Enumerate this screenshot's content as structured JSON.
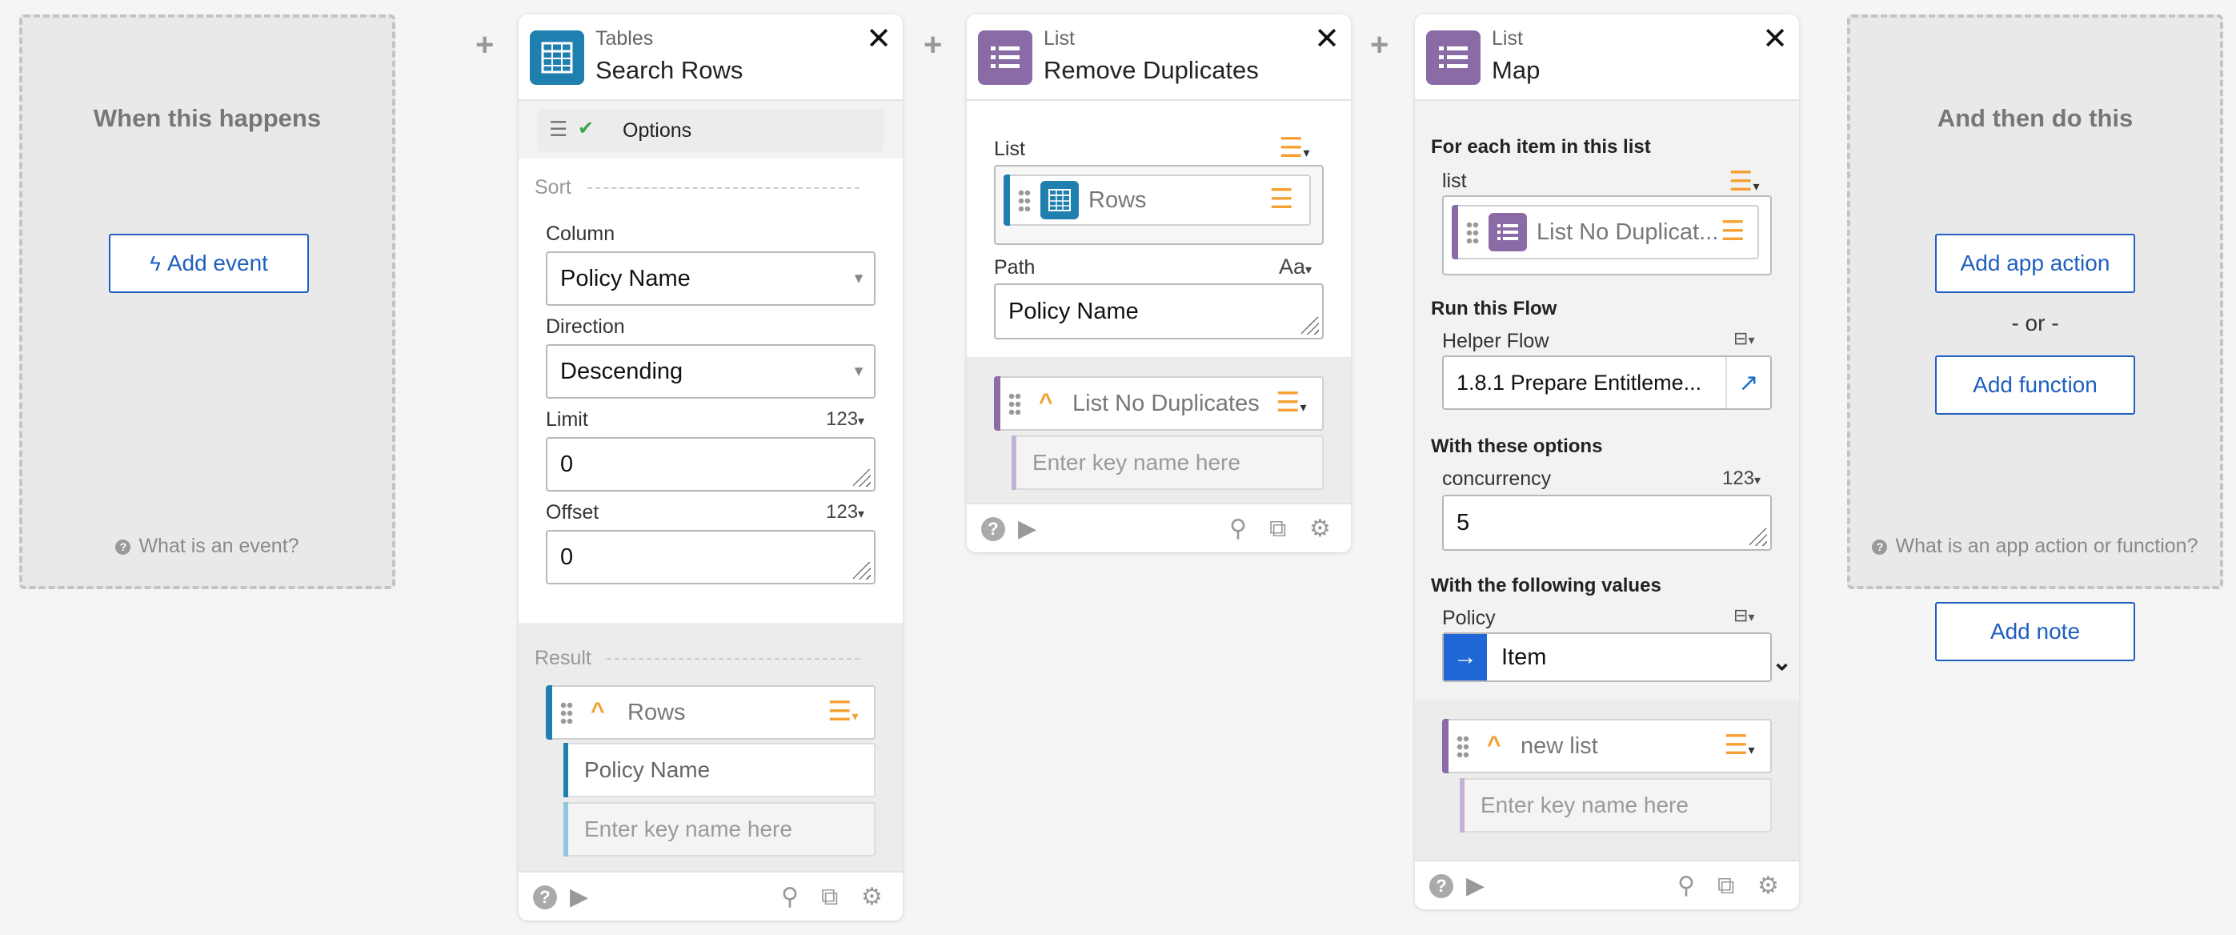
{
  "trigger": {
    "title": "When this happens",
    "add_event": "Add event",
    "help": "What is an event?"
  },
  "steps": [
    {
      "app": "Tables",
      "action": "Search Rows",
      "icon": "table-icon",
      "options_label": "Options",
      "sort_label": "Sort",
      "fields": [
        {
          "label": "Column",
          "value": "Policy Name"
        },
        {
          "label": "Direction",
          "value": "Descending"
        },
        {
          "label": "Limit",
          "value": "0",
          "type": "123"
        },
        {
          "label": "Offset",
          "value": "0",
          "type": "123"
        }
      ],
      "result_label": "Result",
      "result_pill": "Rows",
      "result_values": [
        "Policy Name"
      ],
      "key_placeholder": "Enter key name here"
    },
    {
      "app": "List",
      "action": "Remove Duplicates",
      "icon": "list-icon",
      "list_label": "List",
      "list_pill": "Rows",
      "path_label": "Path",
      "path_type": "Aa",
      "path_value": "Policy Name",
      "result_pill": "List No Duplicates",
      "key_placeholder": "Enter key name here"
    },
    {
      "app": "List",
      "action": "Map",
      "icon": "list-icon",
      "section_each": "For each item in this list",
      "list_label": "list",
      "list_pill": "List No Duplicat...",
      "section_flow": "Run this Flow",
      "helper_label": "Helper Flow",
      "helper_value": "1.8.1 Prepare Entitleme...",
      "section_options": "With these options",
      "concurrency_label": "concurrency",
      "concurrency_type": "123",
      "concurrency_value": "5",
      "section_values": "With the following values",
      "policy_label": "Policy",
      "policy_value": "Item",
      "result_pill": "new list",
      "key_placeholder": "Enter key name here"
    }
  ],
  "end": {
    "title": "And then do this",
    "add_app_action": "Add app action",
    "or": "- or -",
    "add_function": "Add function",
    "help": "What is an app action or function?",
    "add_note": "Add note"
  },
  "colors": {
    "tables": "#1f7fae",
    "list": "#8a6ba6",
    "link": "#1f5fbf",
    "accent_orange": "#f5a030"
  }
}
